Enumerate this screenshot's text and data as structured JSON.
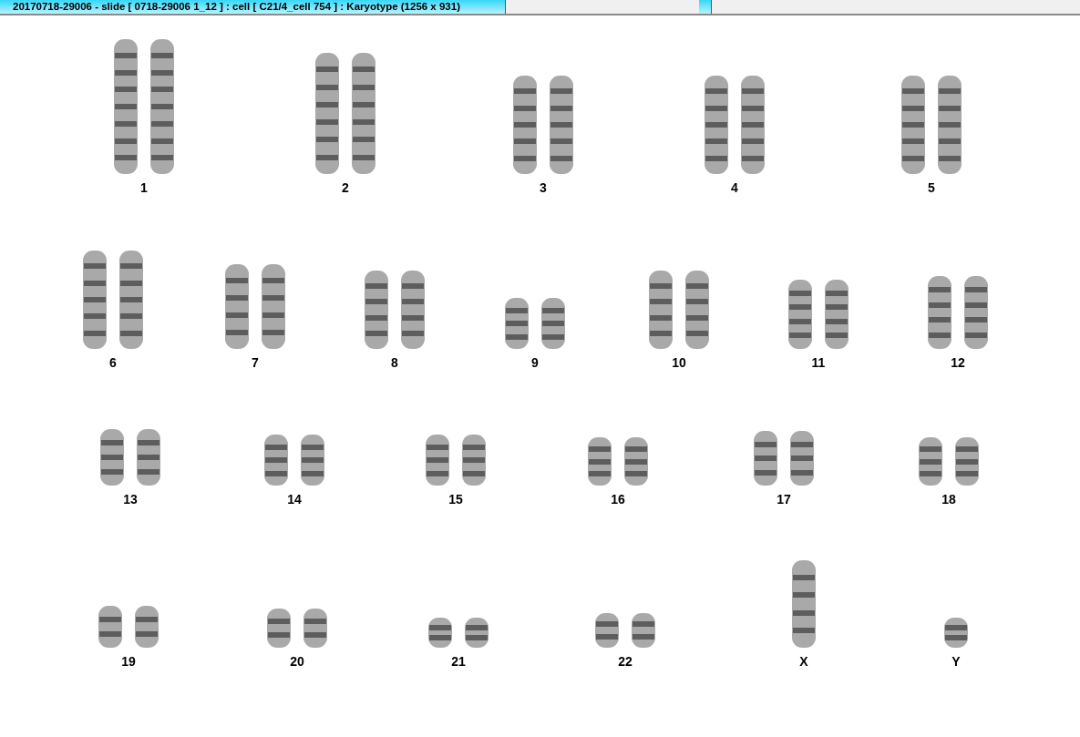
{
  "window": {
    "title": "20170718-29006 - slide [ 0718-29006 1_12 ] : cell [ C21/4_cell 754 ] : Karyotype  (1256 x 931)"
  },
  "chromosomes": [
    {
      "label": "1",
      "kind": "pair"
    },
    {
      "label": "2",
      "kind": "pair"
    },
    {
      "label": "3",
      "kind": "pair"
    },
    {
      "label": "4",
      "kind": "pair"
    },
    {
      "label": "5",
      "kind": "pair"
    },
    {
      "label": "6",
      "kind": "pair"
    },
    {
      "label": "7",
      "kind": "pair"
    },
    {
      "label": "8",
      "kind": "pair"
    },
    {
      "label": "9",
      "kind": "pair"
    },
    {
      "label": "10",
      "kind": "pair"
    },
    {
      "label": "11",
      "kind": "pair"
    },
    {
      "label": "12",
      "kind": "pair"
    },
    {
      "label": "13",
      "kind": "pair"
    },
    {
      "label": "14",
      "kind": "pair"
    },
    {
      "label": "15",
      "kind": "pair"
    },
    {
      "label": "16",
      "kind": "pair"
    },
    {
      "label": "17",
      "kind": "pair"
    },
    {
      "label": "18",
      "kind": "pair"
    },
    {
      "label": "19",
      "kind": "pair"
    },
    {
      "label": "20",
      "kind": "pair"
    },
    {
      "label": "21",
      "kind": "pair"
    },
    {
      "label": "22",
      "kind": "pair"
    },
    {
      "label": "X",
      "kind": "single"
    },
    {
      "label": "Y",
      "kind": "single"
    }
  ]
}
